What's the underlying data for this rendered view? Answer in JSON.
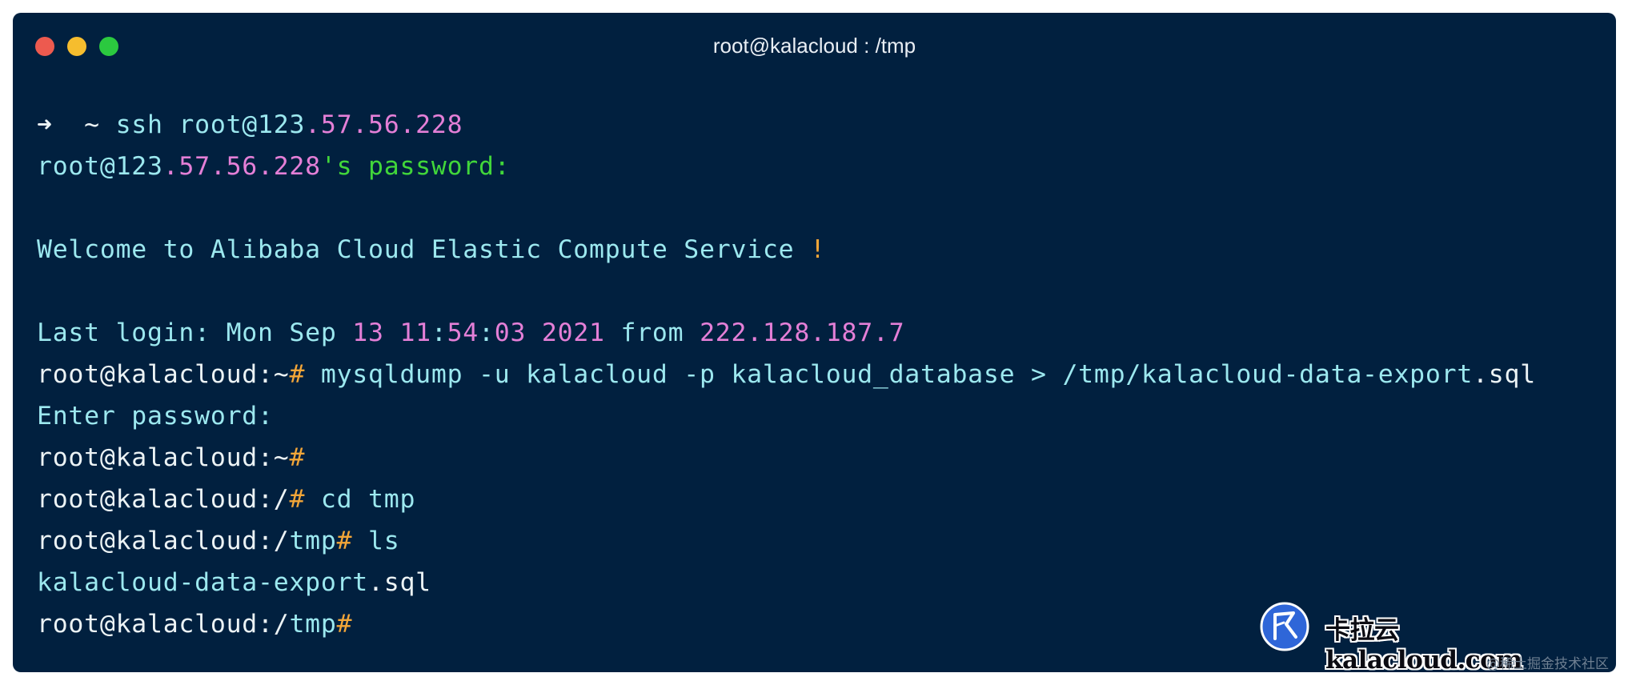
{
  "window": {
    "title": "root@kalacloud : /tmp",
    "controls": {
      "close": {
        "icon": "close-light-icon",
        "color": "#ed5a4f"
      },
      "minimize": {
        "icon": "minimize-light-icon",
        "color": "#f6bd2e"
      },
      "maximize": {
        "icon": "maximize-light-icon",
        "color": "#2bc93f"
      }
    },
    "background": "#01203f"
  },
  "colors": {
    "white": "#ecf3f5",
    "cyan": "#9ce8ef",
    "pink": "#e47fd7",
    "green": "#41d63a",
    "orange": "#f3a638"
  },
  "terminal": {
    "lines": [
      {
        "segments": [
          {
            "text": "➜  ~ ",
            "color": "white"
          },
          {
            "text": "ssh root@123",
            "color": "cyan"
          },
          {
            "text": ".57.56.228",
            "color": "pink"
          }
        ]
      },
      {
        "segments": [
          {
            "text": "root@123",
            "color": "cyan"
          },
          {
            "text": ".57.56.228",
            "color": "pink"
          },
          {
            "text": "'s password:",
            "color": "green"
          }
        ]
      },
      {
        "segments": []
      },
      {
        "segments": [
          {
            "text": "Welcome to Alibaba Cloud Elastic Compute Service ",
            "color": "cyan"
          },
          {
            "text": "!",
            "color": "orange"
          }
        ]
      },
      {
        "segments": []
      },
      {
        "segments": [
          {
            "text": "Last login: Mon Sep ",
            "color": "cyan"
          },
          {
            "text": "13 11",
            "color": "pink"
          },
          {
            "text": ":",
            "color": "cyan"
          },
          {
            "text": "54",
            "color": "pink"
          },
          {
            "text": ":",
            "color": "cyan"
          },
          {
            "text": "03 2021",
            "color": "pink"
          },
          {
            "text": " from ",
            "color": "cyan"
          },
          {
            "text": "222.128.187.7",
            "color": "pink"
          }
        ]
      },
      {
        "segments": [
          {
            "text": "root@kalacloud:~",
            "color": "white"
          },
          {
            "text": "#",
            "color": "orange"
          },
          {
            "text": " mysqldump -u kalacloud -p kalacloud_database > /tmp/kalacloud-data-export",
            "color": "cyan"
          },
          {
            "text": ".sql",
            "color": "white"
          }
        ]
      },
      {
        "segments": [
          {
            "text": "Enter password:",
            "color": "cyan"
          }
        ]
      },
      {
        "segments": [
          {
            "text": "root@kalacloud:~",
            "color": "white"
          },
          {
            "text": "#",
            "color": "orange"
          }
        ]
      },
      {
        "segments": [
          {
            "text": "root@kalacloud:/",
            "color": "white"
          },
          {
            "text": "#",
            "color": "orange"
          },
          {
            "text": " cd tmp",
            "color": "cyan"
          }
        ]
      },
      {
        "segments": [
          {
            "text": "root@kalacloud:/",
            "color": "white"
          },
          {
            "text": "tmp",
            "color": "cyan"
          },
          {
            "text": "#",
            "color": "orange"
          },
          {
            "text": " ls",
            "color": "cyan"
          }
        ]
      },
      {
        "segments": [
          {
            "text": "kalacloud-data-export",
            "color": "cyan"
          },
          {
            "text": ".sql",
            "color": "white"
          }
        ]
      },
      {
        "segments": [
          {
            "text": "root@kalacloud:/",
            "color": "white"
          },
          {
            "text": "tmp",
            "color": "cyan"
          },
          {
            "text": "#",
            "color": "orange"
          }
        ]
      }
    ]
  },
  "watermark": {
    "logo_icon": "kalacloud-logo-icon",
    "text": "卡拉云 kalacloud.com",
    "credit": "@稀土掘金技术社区"
  }
}
